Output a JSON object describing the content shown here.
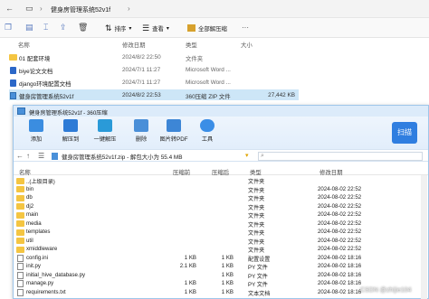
{
  "explorer": {
    "breadcrumb": "健身房管理系统52v1f",
    "toolbar": {
      "sort": "排序",
      "view": "查看",
      "extract_all": "全部解压缩",
      "more": "···"
    },
    "columns": {
      "name": "名称",
      "modified": "修改日期",
      "type": "类型",
      "size": "大小"
    },
    "files": [
      {
        "name": "01 配套环境",
        "date": "2024/8/2 22:50",
        "type": "文件夹",
        "size": "",
        "icon": "folder-icon"
      },
      {
        "name": "biye论文文档",
        "date": "2024/7/1 11:27",
        "type": "Microsoft Word ...",
        "size": "",
        "icon": "word-doc-icon"
      },
      {
        "name": "django环境配置文档",
        "date": "2024/7/1 11:27",
        "type": "Microsoft Word ...",
        "size": "",
        "icon": "word-doc-icon"
      },
      {
        "name": "健身房管理系统52v1f",
        "date": "2024/8/2 22:53",
        "type": "360压缩 ZIP 文件",
        "size": "27,442 KB",
        "icon": "zip-icon",
        "selected": true
      }
    ]
  },
  "zip": {
    "title": "健身房管理系统52v1f - 360压缩",
    "toolbar": [
      {
        "label": "添加",
        "icon": "add-icon",
        "color": "#3b8de0"
      },
      {
        "label": "解压到",
        "icon": "extract-to-icon",
        "color": "#2e7bd6"
      },
      {
        "label": "一键解压",
        "icon": "one-click-extract-icon",
        "color": "#2a9ad8"
      },
      {
        "label": "删除",
        "icon": "delete-icon",
        "color": "#4a8fd8"
      },
      {
        "label": "图片转PDF",
        "icon": "image-to-pdf-icon",
        "color": "#3d86d6"
      },
      {
        "label": "工具",
        "icon": "tools-icon",
        "color": "#3b8ee6"
      }
    ],
    "scan_label": "扫描",
    "path": "健身房管理系统52v1f.zip - 解包大小为 55.4 MB",
    "columns": {
      "name": "名称",
      "compressed": "压缩前",
      "size": "压缩后",
      "type": "类型",
      "modified": "修改日期"
    },
    "rows": [
      {
        "name": "..(上级目录)",
        "compressed": "",
        "size": "",
        "type": "文件夹",
        "date": "",
        "icon": "folder-icon"
      },
      {
        "name": "bin",
        "compressed": "",
        "size": "",
        "type": "文件夹",
        "date": "2024-08-02 22:52",
        "icon": "folder-icon"
      },
      {
        "name": "db",
        "compressed": "",
        "size": "",
        "type": "文件夹",
        "date": "2024-08-02 22:52",
        "icon": "folder-icon"
      },
      {
        "name": "dj2",
        "compressed": "",
        "size": "",
        "type": "文件夹",
        "date": "2024-08-02 22:52",
        "icon": "folder-icon"
      },
      {
        "name": "main",
        "compressed": "",
        "size": "",
        "type": "文件夹",
        "date": "2024-08-02 22:52",
        "icon": "folder-icon"
      },
      {
        "name": "media",
        "compressed": "",
        "size": "",
        "type": "文件夹",
        "date": "2024-08-02 22:52",
        "icon": "folder-icon"
      },
      {
        "name": "templates",
        "compressed": "",
        "size": "",
        "type": "文件夹",
        "date": "2024-08-02 22:52",
        "icon": "folder-icon"
      },
      {
        "name": "util",
        "compressed": "",
        "size": "",
        "type": "文件夹",
        "date": "2024-08-02 22:52",
        "icon": "folder-icon"
      },
      {
        "name": "xmiddleware",
        "compressed": "",
        "size": "",
        "type": "文件夹",
        "date": "2024-08-02 22:52",
        "icon": "folder-icon"
      },
      {
        "name": "config.ini",
        "compressed": "1 KB",
        "size": "1 KB",
        "type": "配置设置",
        "date": "2024-08-02 18:16",
        "icon": "file-icon"
      },
      {
        "name": "init.py",
        "compressed": "2.1 KB",
        "size": "1 KB",
        "type": "PY 文件",
        "date": "2024-08-02 18:16",
        "icon": "file-icon"
      },
      {
        "name": "initial_hive_database.py",
        "compressed": "",
        "size": "1 KB",
        "type": "PY 文件",
        "date": "2024-08-02 18:16",
        "icon": "file-icon"
      },
      {
        "name": "manage.py",
        "compressed": "1 KB",
        "size": "1 KB",
        "type": "PY 文件",
        "date": "2024-08-02 18:16",
        "icon": "file-icon"
      },
      {
        "name": "requirements.txt",
        "compressed": "1 KB",
        "size": "1 KB",
        "type": "文本文档",
        "date": "2024-08-02 18:16",
        "icon": "file-icon"
      }
    ]
  },
  "watermark": "CSDN @zhijie104"
}
